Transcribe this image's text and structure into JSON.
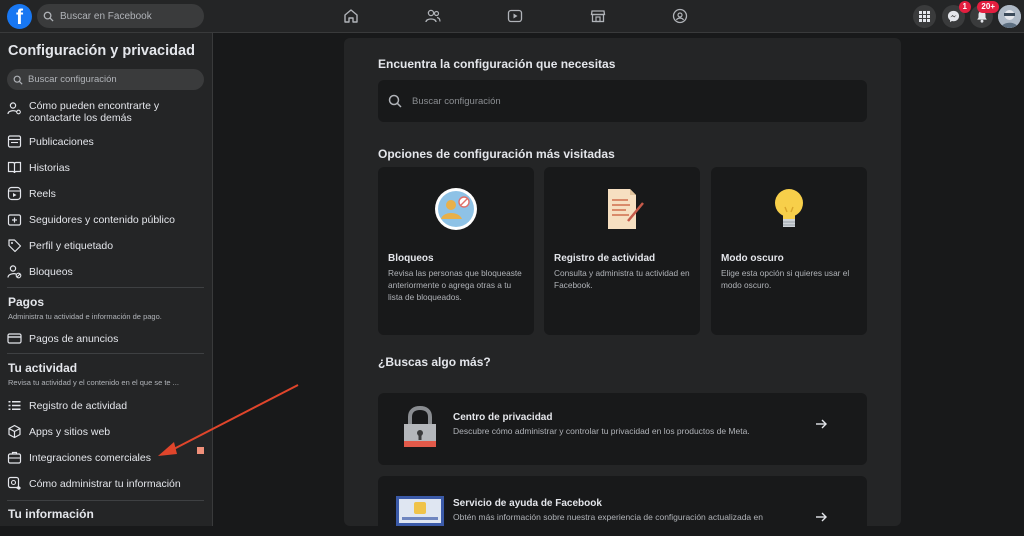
{
  "topbar": {
    "logo": "f",
    "search_placeholder": "Buscar en Facebook",
    "icons": [
      "home-icon",
      "friends-icon",
      "watch-icon",
      "marketplace-icon",
      "groups-icon",
      "menu-grid-icon",
      "messenger-icon",
      "notifications-icon"
    ],
    "messenger_badge": "1",
    "notifications_badge": "20+"
  },
  "sidebar": {
    "title": "Configuración y privacidad",
    "search_placeholder": "Buscar configuración",
    "items": [
      {
        "label_1": "Cómo pueden encontrarte y",
        "label_2": "contactarte los demás",
        "icon": "person-search-icon"
      },
      {
        "label": "Publicaciones",
        "icon": "posts-icon"
      },
      {
        "label": "Historias",
        "icon": "book-icon"
      },
      {
        "label": "Reels",
        "icon": "reels-icon"
      },
      {
        "label": "Seguidores y contenido público",
        "icon": "followers-icon"
      },
      {
        "label": "Perfil y etiquetado",
        "icon": "tag-icon"
      },
      {
        "label": "Bloqueos",
        "icon": "block-person-icon"
      }
    ],
    "pagos": {
      "title": "Pagos",
      "subtitle": "Administra tu actividad e información de pago.",
      "items": [
        {
          "label": "Pagos de anuncios",
          "icon": "card-icon"
        }
      ]
    },
    "actividad": {
      "title": "Tu actividad",
      "subtitle": "Revisa tu actividad y el contenido en el que se te ...",
      "items": [
        {
          "label": "Registro de actividad",
          "icon": "list-icon"
        },
        {
          "label": "Apps y sitios web",
          "icon": "cube-icon"
        },
        {
          "label": "Integraciones comerciales",
          "icon": "briefcase-icon"
        },
        {
          "label": "Cómo administrar tu información",
          "icon": "info-manage-icon"
        }
      ]
    },
    "informacion": {
      "title": "Tu información"
    }
  },
  "main": {
    "find_heading": "Encuentra la configuración que necesitas",
    "search_placeholder": "Buscar configuración",
    "popular_heading": "Opciones de configuración más visitadas",
    "cards": [
      {
        "title": "Bloqueos",
        "desc": "Revisa las personas que bloqueaste anteriormente o agrega otras a tu lista de bloqueados."
      },
      {
        "title": "Registro de actividad",
        "desc": "Consulta y administra tu actividad en Facebook."
      },
      {
        "title": "Modo oscuro",
        "desc": "Elige esta opción si quieres usar el modo oscuro."
      }
    ],
    "more_heading": "¿Buscas algo más?",
    "rows": [
      {
        "title": "Centro de privacidad",
        "desc": "Descubre cómo administrar y controlar tu privacidad en los productos de Meta."
      },
      {
        "title": "Servicio de ayuda de Facebook",
        "desc": "Obtén más información sobre nuestra experiencia de configuración actualizada en"
      }
    ]
  },
  "colors": {
    "accent": "#1877f2",
    "annotation_arrow": "#e0452b",
    "badge": "#e41e3f"
  }
}
